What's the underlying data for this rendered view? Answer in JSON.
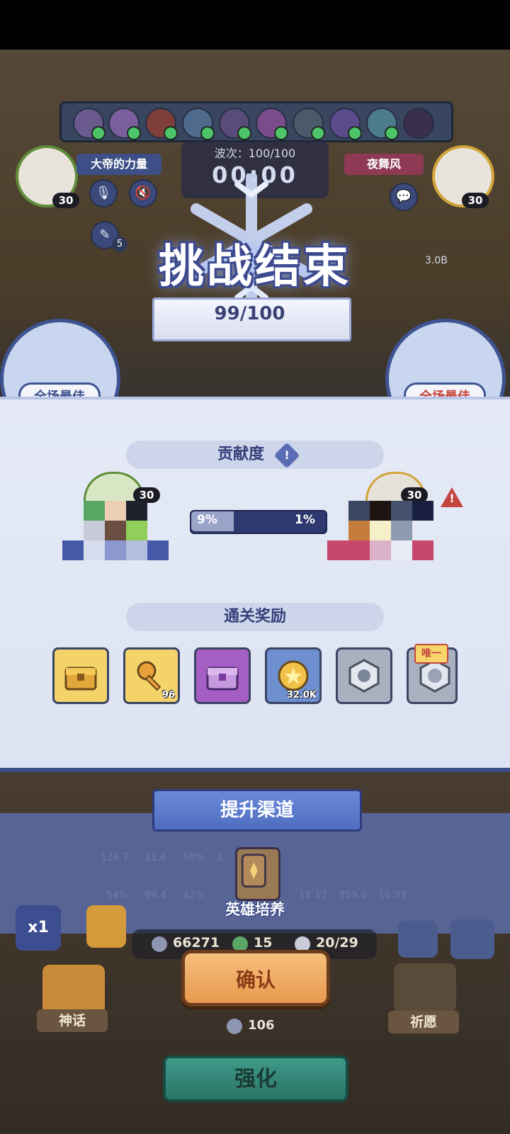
{
  "top_panel": {
    "left_player": {
      "name": "大帝的力量",
      "level": "30"
    },
    "right_player": {
      "name": "夜舞风",
      "level": "30"
    },
    "wave_label": "波次：100/100",
    "timer": "00:00",
    "notes_count": "5",
    "speed_value": "3.0B"
  },
  "result": {
    "title": "挑战结束",
    "score": "99/100",
    "mvp_left": "全场最佳",
    "mvp_right": "全场最佳"
  },
  "contribution": {
    "heading": "贡献度",
    "info_icon": "!",
    "left_level": "30",
    "right_level": "30",
    "left_percent": "9%",
    "right_percent": "1%",
    "warning_icon": "!"
  },
  "rewards": {
    "heading": "通关奖励",
    "items": [
      {
        "name": "gold-chest",
        "count": ""
      },
      {
        "name": "key",
        "count": "96"
      },
      {
        "name": "purple-chest",
        "count": ""
      },
      {
        "name": "coin",
        "count": "32.0K"
      },
      {
        "name": "emblem",
        "count": ""
      },
      {
        "name": "unique-emblem",
        "count": "",
        "tag": "唯一"
      }
    ]
  },
  "upgrade_channel": {
    "heading": "提升渠道",
    "option_label": "英雄培养",
    "stats_row1": [
      "126.7",
      "11.6",
      "50%",
      "2"
    ],
    "stats_row2": [
      "54%",
      "99.4",
      "42%",
      "18.17",
      "359.6",
      "16.33"
    ]
  },
  "hud": {
    "speed": "x1",
    "silver": "66271",
    "clover": "15",
    "units": "20/29",
    "confirm": "确认",
    "coins": "106",
    "myth": "神话",
    "wish": "祈愿",
    "enhance": "强化"
  },
  "colors": {
    "panel": "#e5eaf6",
    "accent_blue": "#3e5391",
    "confirm_orange": "#e79a4f",
    "enhance_teal": "#2a7466",
    "warning_red": "#c4453f"
  }
}
